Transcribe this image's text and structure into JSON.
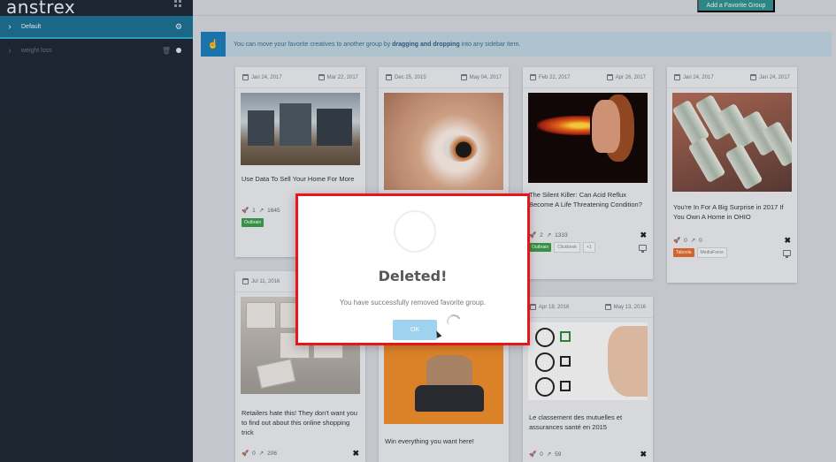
{
  "app": {
    "logo": "anstrex"
  },
  "sidebar": {
    "items": [
      {
        "label": "Default",
        "active": true
      },
      {
        "label": "weight loss",
        "active": false
      }
    ]
  },
  "toolbar": {
    "add_group_label": "Add a Favorite Group"
  },
  "info": {
    "text_prefix": "You can move your favorite creatives to another group by ",
    "text_bold": "dragging and dropping",
    "text_suffix": " into any sidebar item."
  },
  "cards": [
    {
      "start": "Jan 24, 2017",
      "end": "Mar 22, 2017",
      "title": "Use Data To Sell Your Home For More",
      "shares": "1",
      "trend": "1645",
      "tags": [
        "Outbrain"
      ]
    },
    {
      "start": "Dec 25, 2015",
      "end": "May 04, 2017",
      "title": "",
      "shares": "",
      "trend": "",
      "tags": []
    },
    {
      "start": "Feb 22, 2017",
      "end": "Apr 26, 2017",
      "title": "The Silent Killer: Can Acid Reflux Become A Life Threatening Condition?",
      "shares": "2",
      "trend": "1333",
      "tags": [
        "Outbrain",
        "Clickbook",
        "+1"
      ]
    },
    {
      "start": "Jan 24, 2017",
      "end": "Jan 24, 2017",
      "title": "You're In For A Big Surprise in 2017 If You Own A Home in OHIO",
      "shares": "0",
      "trend": "0",
      "tags": [
        "Taboola",
        "MediaForce"
      ]
    },
    {
      "start": "Jul 11, 2016",
      "end": "",
      "title": "Retailers hate this! They don't want you to find out about this online shopping trick",
      "shares": "0",
      "trend": "206",
      "tags": []
    },
    {
      "start": "",
      "end": "",
      "title": "Win everything you want here!",
      "shares": "",
      "trend": "",
      "tags": []
    },
    {
      "start": "Apr 18, 2016",
      "end": "May 13, 2016",
      "title": "Le classement des mutuelles et assurances santé en 2015",
      "shares": "0",
      "trend": "59",
      "tags": []
    }
  ],
  "modal": {
    "title": "Deleted!",
    "text": "You have successfully removed favorite group.",
    "ok_label": "OK"
  },
  "colors": {
    "sidebar_bg": "#1f2733",
    "active_item": "#1c6d8f",
    "modal_border": "#e8151b",
    "ok_button": "#9fd2ef"
  }
}
